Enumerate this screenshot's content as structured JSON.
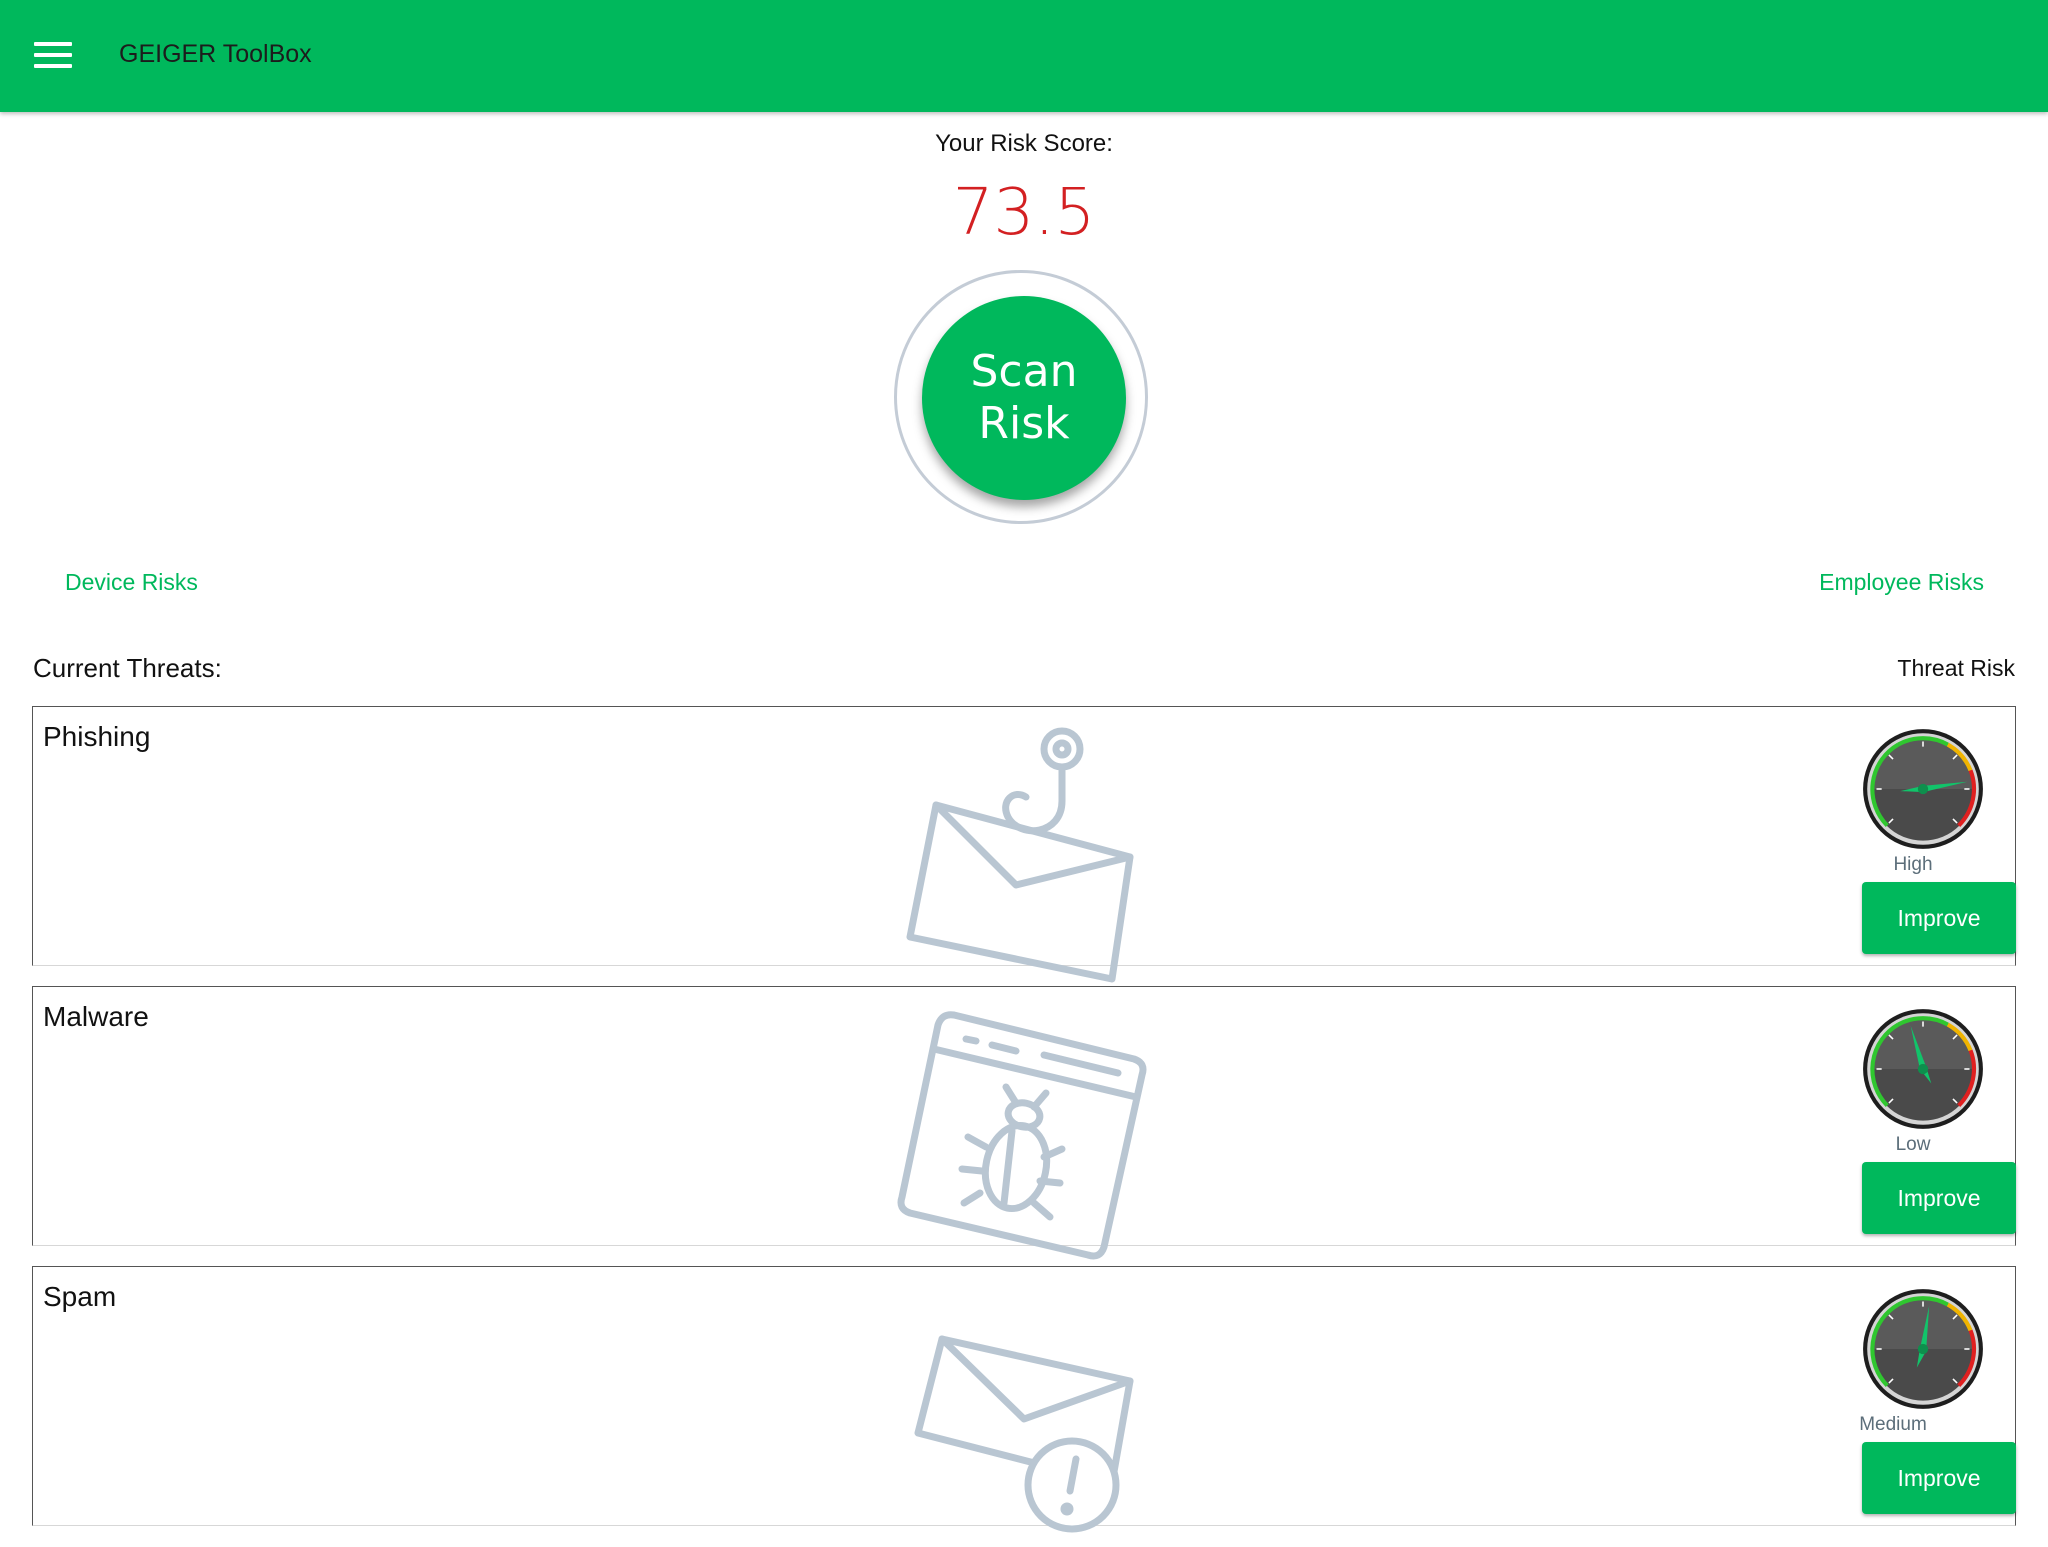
{
  "app": {
    "title": "GEIGER ToolBox",
    "brand_color": "#00b85c",
    "menu_icon": "hamburger-menu-icon"
  },
  "risk": {
    "label": "Your Risk Score:",
    "score": "73.5",
    "score_color": "#d32022",
    "scan_line1": "Scan",
    "scan_line2": "Risk"
  },
  "links": {
    "device": "Device Risks",
    "employee": "Employee Risks"
  },
  "threats": {
    "heading": "Current Threats:",
    "risk_column": "Threat Risk",
    "items": [
      {
        "name": "Phishing",
        "icon": "phishing-envelope-hook-icon",
        "risk": "High",
        "button": "Improve",
        "gauge_level": 0.78
      },
      {
        "name": "Malware",
        "icon": "malware-bug-window-icon",
        "risk": "Low",
        "button": "Improve",
        "gauge_level": 0.3
      },
      {
        "name": "Spam",
        "icon": "spam-envelope-warning-icon",
        "risk": "Medium",
        "button": "Improve",
        "gauge_level": 0.55
      }
    ]
  }
}
